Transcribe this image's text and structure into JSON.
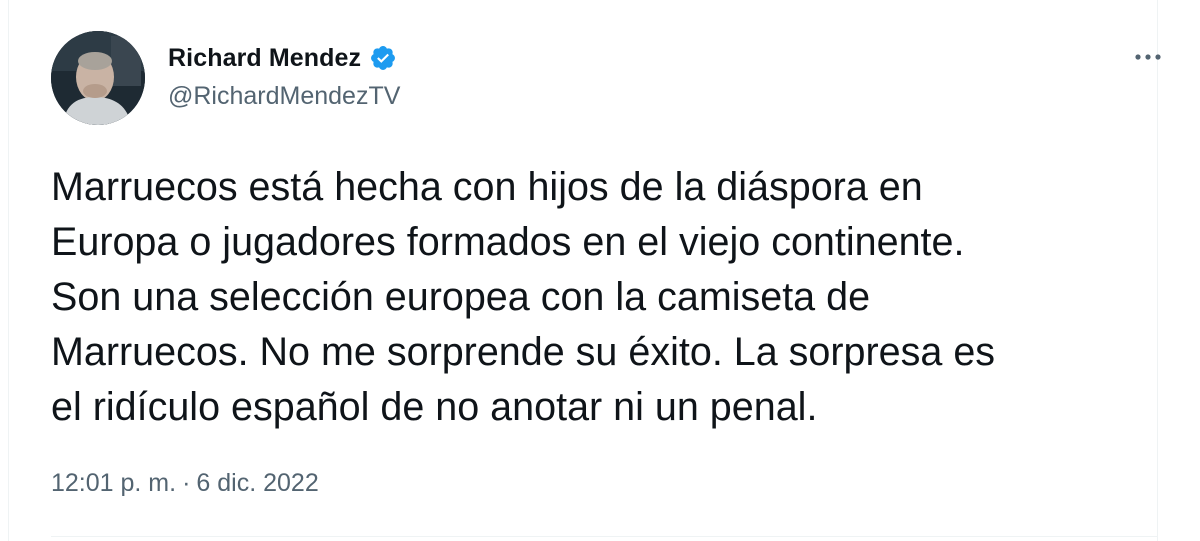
{
  "tweet": {
    "author": {
      "display_name": "Richard Mendez",
      "handle": "@RichardMendezTV",
      "verified": true,
      "verified_color": "#1d9bf0"
    },
    "text": "Marruecos está hecha con hijos de la diáspora en\nEuropa o jugadores formados en el viejo continente.\nSon una selección europea con la camiseta de\nMarruecos. No me sorprende su éxito. La sorpresa es\nel ridículo español de no anotar ni un penal.",
    "time": "12:01 p. m.",
    "separator": "·",
    "date": "6 dic. 2022",
    "icons": {
      "verified": "verified-badge-icon",
      "more": "more-options-icon"
    }
  }
}
